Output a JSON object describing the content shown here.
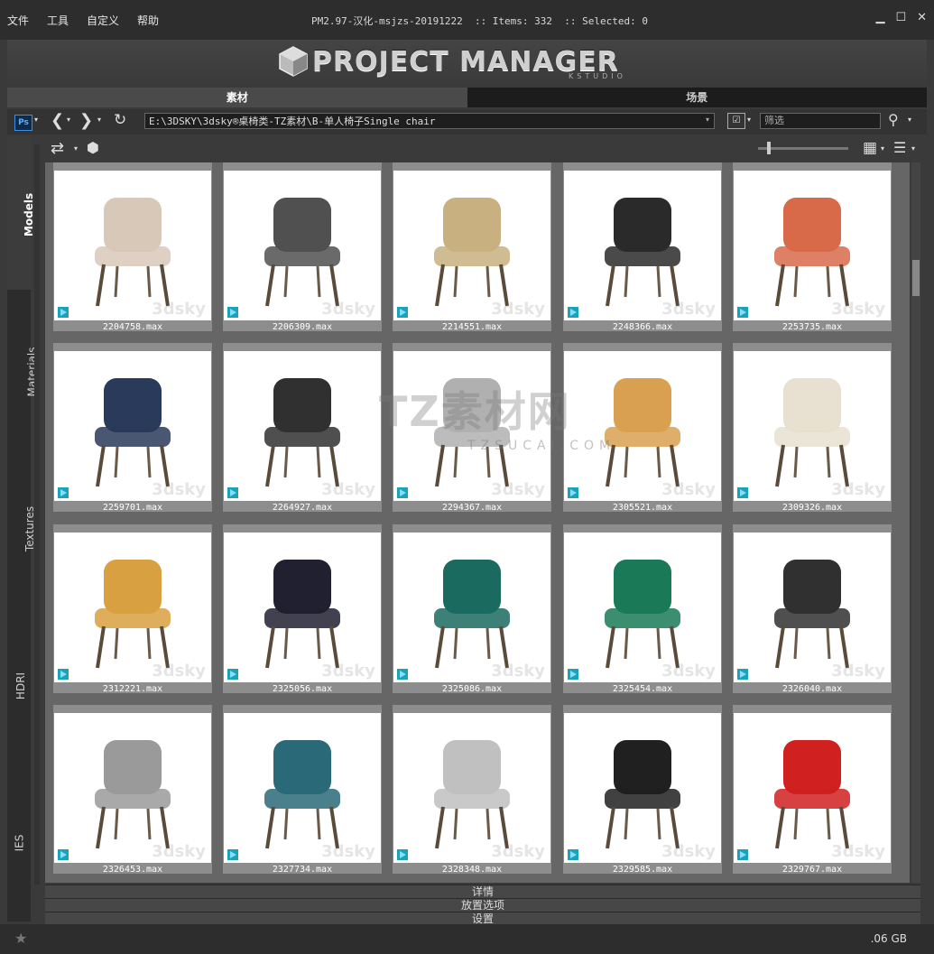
{
  "menu": [
    "文件",
    "工具",
    "自定义",
    "帮助"
  ],
  "window_title": "PM2.97-汉化-msjzs-20191222  :: Items: 332  :: Selected: 0",
  "window_controls": [
    "minimize-icon",
    "maximize-icon",
    "close-icon"
  ],
  "logo": {
    "text": "PROJECT MANAGER",
    "subtext": "KSTUDIO"
  },
  "tabs": [
    {
      "label": "素材",
      "active": true
    },
    {
      "label": "场景",
      "active": false
    }
  ],
  "address": {
    "path": "E:\\3DSKY\\3dsky®桌椅类-TZ素材\\B-单人椅子Single chair",
    "filter_placeholder": "筛选"
  },
  "side_tabs": [
    "Models",
    "Materials",
    "Textures",
    "HDRI",
    "IES"
  ],
  "items": [
    {
      "name": "2204758.max",
      "color": "#d8c8b8"
    },
    {
      "name": "2206309.max",
      "color": "#505050"
    },
    {
      "name": "2214551.max",
      "color": "#c8b080"
    },
    {
      "name": "2248366.max",
      "color": "#2a2a2a"
    },
    {
      "name": "2253735.max",
      "color": "#d86a4a"
    },
    {
      "name": "2259701.max",
      "color": "#2a3a5a"
    },
    {
      "name": "2264927.max",
      "color": "#303030"
    },
    {
      "name": "2294367.max",
      "color": "#b0b0b0"
    },
    {
      "name": "2305521.max",
      "color": "#d8a050"
    },
    {
      "name": "2309326.max",
      "color": "#e8e0d0"
    },
    {
      "name": "2312221.max",
      "color": "#d8a040"
    },
    {
      "name": "2325056.max",
      "color": "#202030"
    },
    {
      "name": "2325086.max",
      "color": "#1a6a60"
    },
    {
      "name": "2325454.max",
      "color": "#1a7a58"
    },
    {
      "name": "2326040.max",
      "color": "#303030"
    },
    {
      "name": "2326453.max",
      "color": "#9a9a9a"
    },
    {
      "name": "2327734.max",
      "color": "#2a6a78"
    },
    {
      "name": "2328348.max",
      "color": "#c0c0c0"
    },
    {
      "name": "2329585.max",
      "color": "#202020"
    },
    {
      "name": "2329767.max",
      "color": "#d02020"
    }
  ],
  "item_watermark": "3dsky",
  "center_watermark": {
    "title": "TZ素材网",
    "url": "TZSUCAI.COM"
  },
  "bottom_panels": [
    "详情",
    "放置选项",
    "设置"
  ],
  "status": {
    "disk": ".06 GB"
  },
  "colors": {
    "titlebar": "#2d2d2d",
    "grid_bg": "#666666",
    "card_bg": "#8d8d8d",
    "tab_active": "#4a4a4a"
  }
}
